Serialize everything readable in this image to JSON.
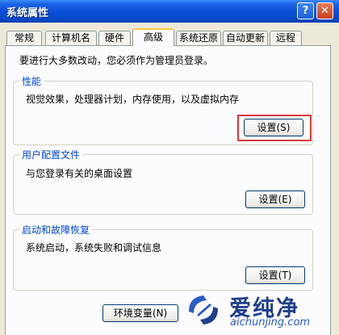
{
  "window": {
    "title": "系统属性"
  },
  "titlebar": {
    "help_glyph": "?",
    "close_glyph": "✕"
  },
  "tabs": [
    {
      "label": "常规"
    },
    {
      "label": "计算机名"
    },
    {
      "label": "硬件"
    },
    {
      "label": "高级",
      "active": true
    },
    {
      "label": "系统还原"
    },
    {
      "label": "自动更新"
    },
    {
      "label": "远程"
    }
  ],
  "notice": "要进行大多数改动，您必须作为管理员登录。",
  "performance": {
    "title": "性能",
    "description": "视觉效果，处理器计划，内存使用，以及虚拟内存",
    "button": "设置(S)"
  },
  "user_profiles": {
    "title": "用户配置文件",
    "description": "与您登录有关的桌面设置",
    "button": "设置(E)"
  },
  "startup_recovery": {
    "title": "启动和故障恢复",
    "description": "系统启动，系统失败和调试信息",
    "button": "设置(T)"
  },
  "env_button": "环境变量(N)",
  "watermark": {
    "title": "爱纯净",
    "url": "aichunjing.com"
  },
  "colors": {
    "title_bar": "#0A50D8",
    "group_title": "#0046D5",
    "highlight": "#D63A3A",
    "active_tab_accent": "#FFC73C"
  }
}
